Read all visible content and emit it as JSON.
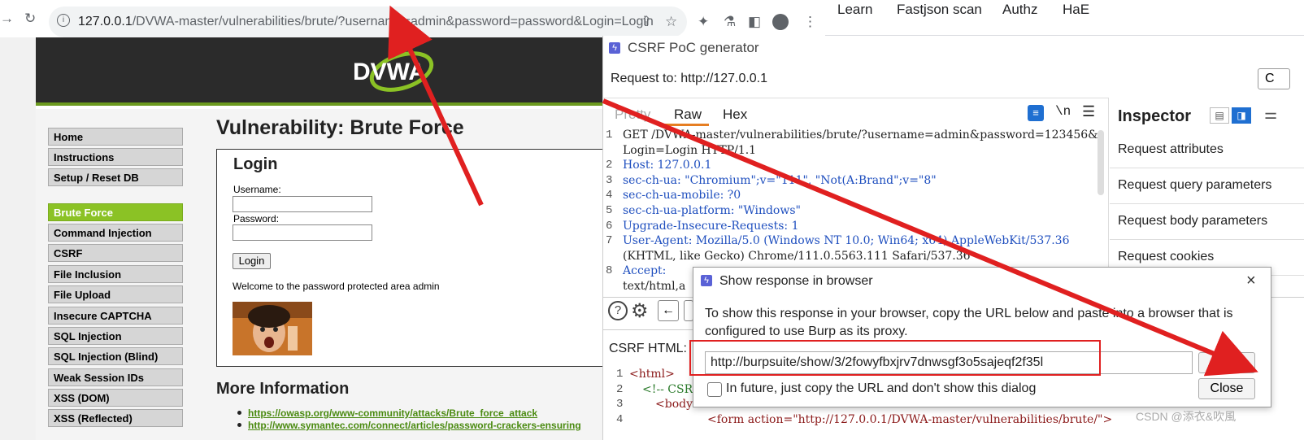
{
  "browser": {
    "url_base": "127.0.0.1",
    "url_path": "/DVWA-master/vulnerabilities/brute/?username=admin&password=password&Login=Login",
    "bookmarks": [
      "Learn",
      "Fastjson scan",
      "Authz",
      "HaE"
    ]
  },
  "dvwa": {
    "logo": "DVWA",
    "menu": [
      {
        "label": "Home",
        "active": false
      },
      {
        "label": "Instructions",
        "active": false
      },
      {
        "label": "Setup / Reset DB",
        "active": false
      },
      {
        "label": "Brute Force",
        "active": true
      },
      {
        "label": "Command Injection",
        "active": false
      },
      {
        "label": "CSRF",
        "active": false
      },
      {
        "label": "File Inclusion",
        "active": false
      },
      {
        "label": "File Upload",
        "active": false
      },
      {
        "label": "Insecure CAPTCHA",
        "active": false
      },
      {
        "label": "SQL Injection",
        "active": false
      },
      {
        "label": "SQL Injection (Blind)",
        "active": false
      },
      {
        "label": "Weak Session IDs",
        "active": false
      },
      {
        "label": "XSS (DOM)",
        "active": false
      },
      {
        "label": "XSS (Reflected)",
        "active": false
      }
    ],
    "title": "Vulnerability: Brute Force",
    "login_heading": "Login",
    "username_label": "Username:",
    "password_label": "Password:",
    "login_button": "Login",
    "welcome": "Welcome to the password protected area admin",
    "more_info": "More Information",
    "links": [
      "https://owasp.org/www-community/attacks/Brute_force_attack",
      "http://www.symantec.com/connect/articles/password-crackers-ensuring"
    ]
  },
  "burp": {
    "window_title": "CSRF PoC generator",
    "request_to": "Request to: http://127.0.0.1",
    "tabs": [
      "Pretty",
      "Raw",
      "Hex"
    ],
    "active_tab": "Raw",
    "newline_toggle": "\\n",
    "request_lines": [
      {
        "n": "1",
        "text": "GET /DVWA-master/vulnerabilities/brute/?username=admin&password=123456&"
      },
      {
        "n": "",
        "text": "Login=Login HTTP/1.1"
      },
      {
        "n": "2",
        "text": "Host: 127.0.0.1"
      },
      {
        "n": "3",
        "text": "sec-ch-ua: \"Chromium\";v=\"111\", \"Not(A:Brand\";v=\"8\""
      },
      {
        "n": "4",
        "text": "sec-ch-ua-mobile: ?0"
      },
      {
        "n": "5",
        "text": "sec-ch-ua-platform: \"Windows\""
      },
      {
        "n": "6",
        "text": "Upgrade-Insecure-Requests: 1"
      },
      {
        "n": "7",
        "text": "User-Agent: Mozilla/5.0 (Windows NT 10.0; Win64; x64) AppleWebKit/537.36"
      },
      {
        "n": "",
        "text": "(KHTML, like Gecko) Chrome/111.0.5563.111 Safari/537.36"
      },
      {
        "n": "8",
        "text": "Accept:"
      },
      {
        "n": "",
        "text": "text/html,a"
      }
    ],
    "inspector_title": "Inspector",
    "inspector_rows": [
      "Request attributes",
      "Request query parameters",
      "Request body parameters",
      "Request cookies"
    ],
    "csrf_label": "CSRF HTML:",
    "csrf_lines": [
      {
        "n": "1",
        "text": "<html>"
      },
      {
        "n": "2",
        "text": "<!-- CSR"
      },
      {
        "n": "3",
        "text": "<body>"
      },
      {
        "n": "4",
        "text": "<form action=\"http://127.0.0.1/DVWA-master/vulnerabilities/brute/\">"
      }
    ],
    "side_button_partial": "C"
  },
  "dialog": {
    "title": "Show response in browser",
    "text": "To show this response in your browser, copy the URL below and paste into a browser that is configured to use Burp as its proxy.",
    "url": "http://burpsuite/show/3/2fowyfbxjrv7dnwsgf3o5sajeqf2f35l",
    "copy_button": "Copy",
    "close_button": "Close",
    "checkbox_label": "In future, just copy the URL and don't show this dialog"
  },
  "watermark": "CSDN @添衣&吹風",
  "colors": {
    "dvwa_green": "#8bc225",
    "burp_accent": "#1f6fd1",
    "annotation_red": "#e02020"
  }
}
